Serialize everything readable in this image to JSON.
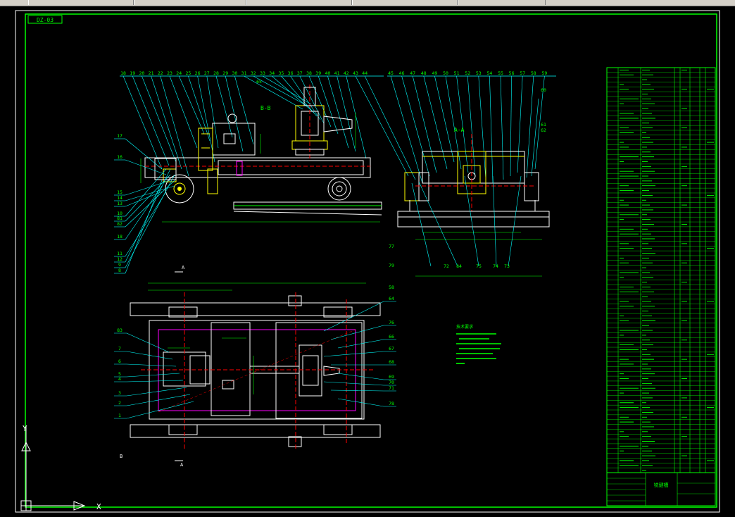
{
  "drawing_code": "DZ-03",
  "section_bb": "B-B",
  "section_aa": "A-A",
  "view_marker": "A",
  "bottom_marker": "B",
  "tech_title": "技术要求",
  "top_balloons": [
    "18",
    "19",
    "20",
    "21",
    "22",
    "23",
    "24",
    "25",
    "26",
    "27",
    "28",
    "29",
    "30",
    "31",
    "32",
    "33",
    "34",
    "35",
    "36",
    "37",
    "38",
    "39",
    "40",
    "41",
    "42",
    "43",
    "44",
    "45",
    "46",
    "47",
    "48",
    "49",
    "50",
    "51",
    "52",
    "53",
    "54",
    "55",
    "56",
    "57",
    "58",
    "59"
  ],
  "balloons_left_bb": [
    "17",
    "16",
    "15",
    "14",
    "13",
    "10",
    "81",
    "82",
    "18",
    "11",
    "12",
    "9",
    "8"
  ],
  "balloons_left_plan": [
    "83",
    "7",
    "6",
    "5",
    "4",
    "3",
    "2",
    "1"
  ],
  "balloons_right_plan": [
    "64",
    "76",
    "66",
    "67",
    "68",
    "69",
    "70",
    "71",
    "78"
  ],
  "balloons_misc": [
    "65",
    "77",
    "79",
    "58",
    "60",
    "61",
    "62",
    "72",
    "84",
    "75",
    "74",
    "73"
  ],
  "title_block_name": "铣键槽",
  "ucs_y": "Y",
  "ucs_x": "X",
  "colors": {
    "green": "#00ff00",
    "cyan": "#00ffff",
    "white": "#ffffff",
    "yellow": "#ffff00",
    "red": "#ff0000",
    "magenta": "#ff00ff",
    "bg": "#000000"
  }
}
